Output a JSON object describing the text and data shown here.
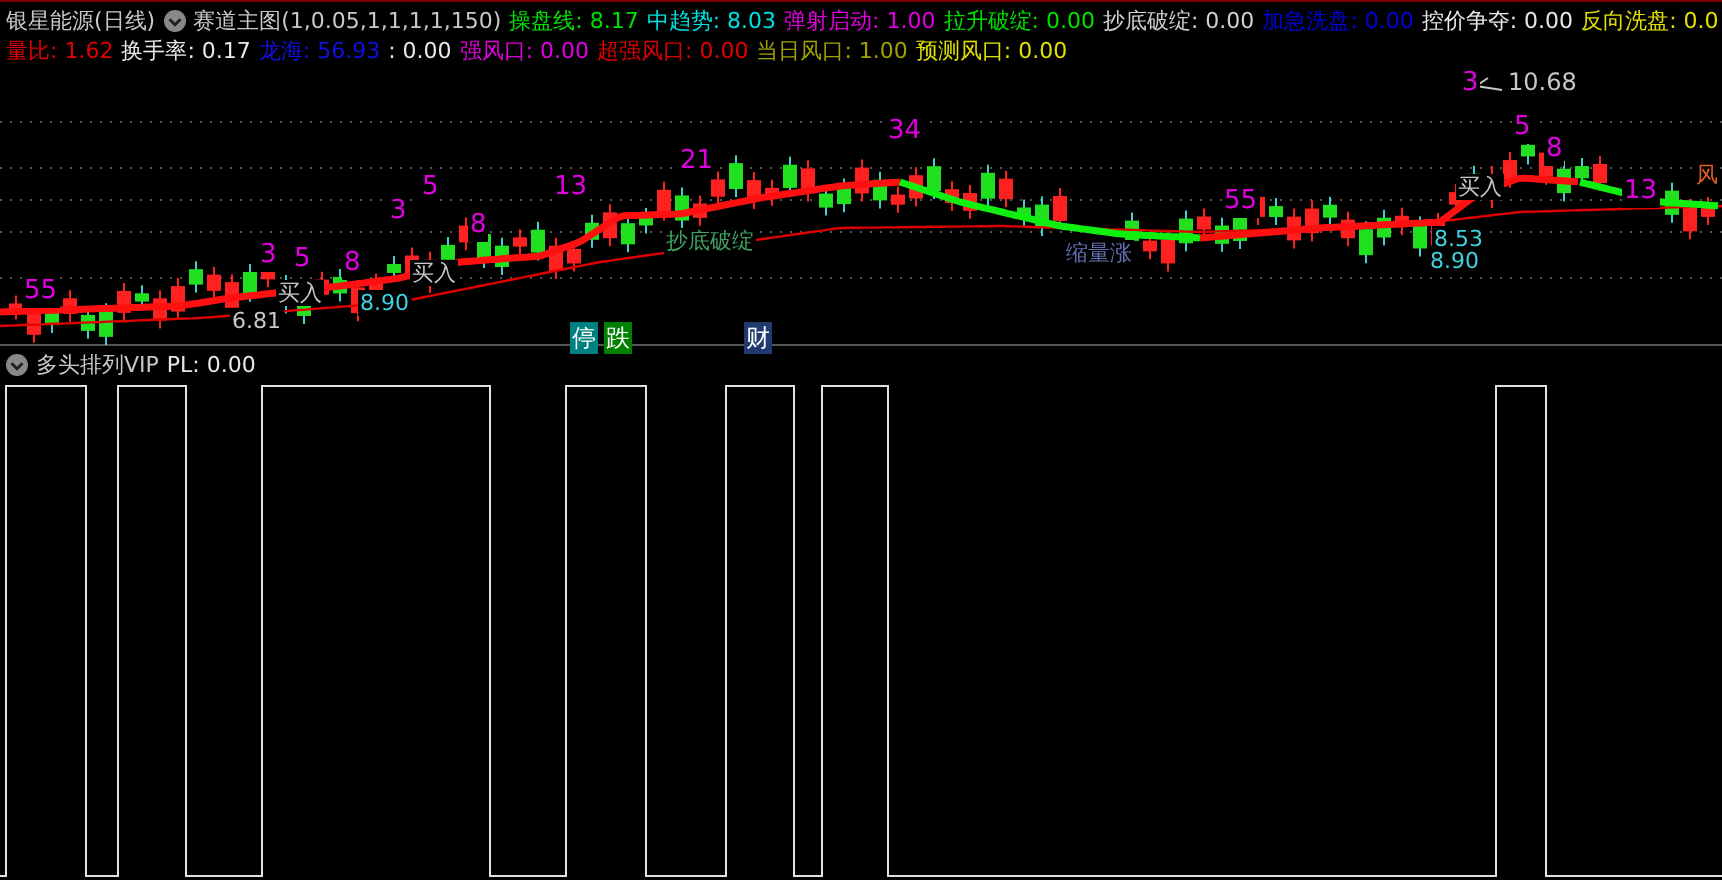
{
  "main_panel": {
    "security": "银星能源(日线)",
    "indicator": "赛道主图(1,0.05,1,1,1,1,150)",
    "legend_rows": [
      [
        {
          "text": "操盘线: 8.17",
          "color": "#00e000"
        },
        {
          "text": "中趋势: 8.03",
          "color": "#00e0e0"
        },
        {
          "text": "弹射启动: 1.00",
          "color": "#e000e0"
        },
        {
          "text": "拉升破绽: 0.00",
          "color": "#00e000"
        },
        {
          "text": "抄底破绽: 0.00",
          "color": "#d0d0d0"
        },
        {
          "text": "加急洗盘: 0.00",
          "color": "#0000e0"
        },
        {
          "text": "控价争夺: 0.00",
          "color": "#e8e8e8"
        },
        {
          "text": "反向洗盘: 0.0",
          "color": "#e0e000"
        }
      ],
      [
        {
          "text": "量比: 1.62",
          "color": "#e00000"
        },
        {
          "text": "换手率: 0.17",
          "color": "#e8e8e8"
        },
        {
          "text": "龙海: 56.93",
          "color": "#1010e0"
        },
        {
          "text": ": 0.00",
          "color": "#e8e8e8"
        },
        {
          "text": "强风口: 0.00",
          "color": "#e000e0"
        },
        {
          "text": "超强风口: 0.00",
          "color": "#e00000"
        },
        {
          "text": "当日风口: 1.00",
          "color": "#a0a000"
        },
        {
          "text": "预测风口: 0.00",
          "color": "#e0e000"
        }
      ]
    ],
    "annotations": [
      {
        "text": "55",
        "kind": "count",
        "color": "#e000e0"
      },
      {
        "text": "3",
        "kind": "count",
        "color": "#e000e0"
      },
      {
        "text": "5",
        "kind": "count",
        "color": "#e000e0"
      },
      {
        "text": "8",
        "kind": "count",
        "color": "#e000e0"
      },
      {
        "text": "3",
        "kind": "count",
        "color": "#e000e0"
      },
      {
        "text": "5",
        "kind": "count",
        "color": "#e000e0"
      },
      {
        "text": "8",
        "kind": "count",
        "color": "#e000e0"
      },
      {
        "text": "13",
        "kind": "count",
        "color": "#e000e0"
      },
      {
        "text": "21",
        "kind": "count",
        "color": "#e000e0"
      },
      {
        "text": "34",
        "kind": "count",
        "color": "#e000e0"
      },
      {
        "text": "55",
        "kind": "count",
        "color": "#e000e0"
      },
      {
        "text": "3",
        "kind": "count",
        "color": "#e000e0"
      },
      {
        "text": "5",
        "kind": "count",
        "color": "#e000e0"
      },
      {
        "text": "8",
        "kind": "count",
        "color": "#e000e0"
      },
      {
        "text": "13",
        "kind": "count",
        "color": "#e000e0"
      },
      {
        "text": "10.68",
        "kind": "price",
        "color": "#c8c8c8"
      },
      {
        "text": "买入",
        "kind": "note",
        "color": "#c8c8c8"
      },
      {
        "text": "买入",
        "kind": "note",
        "color": "#c8c8c8"
      },
      {
        "text": "买入",
        "kind": "note",
        "color": "#c8c8c8"
      },
      {
        "text": "6.81",
        "kind": "note",
        "color": "#c8c8c8"
      },
      {
        "text": "8.90",
        "kind": "note",
        "color": "#40d0e0"
      },
      {
        "text": "8.53",
        "kind": "note",
        "color": "#40d0e0"
      },
      {
        "text": "8.90",
        "kind": "note",
        "color": "#40d0e0"
      },
      {
        "text": "抄底破绽",
        "kind": "note",
        "color": "#40a060"
      },
      {
        "text": "缩量涨",
        "kind": "note",
        "color": "#6070b0"
      },
      {
        "text": "风",
        "kind": "note",
        "color": "#e06020"
      },
      {
        "text": "停",
        "kind": "tag",
        "color": "#008080"
      },
      {
        "text": "跌",
        "kind": "tag",
        "color": "#008000"
      },
      {
        "text": "财",
        "kind": "tag",
        "color": "#203a70"
      }
    ]
  },
  "sub_panel": {
    "indicator": "多头排列VIP",
    "legend": [
      {
        "text": "PL: 0.00",
        "color": "#e8e8e8"
      }
    ]
  }
}
